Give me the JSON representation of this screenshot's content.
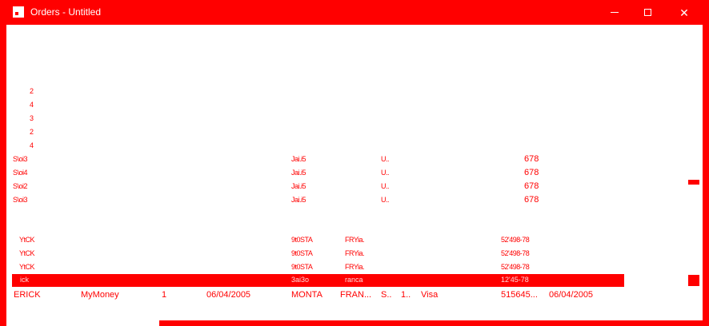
{
  "window": {
    "title": "Orders - Untitled",
    "minimize_glyph": "—",
    "maximize_glyph": "☐",
    "close_glyph": "✕"
  },
  "header_digits": [
    "2",
    "4",
    "3",
    "2",
    "4"
  ],
  "group_a": [
    {
      "id": "S\\oi3",
      "city": "Jai.i5",
      "code": "U..",
      "amount": "678"
    },
    {
      "id": "S\\oi4",
      "city": "Jai.i5",
      "code": "U..",
      "amount": "678"
    },
    {
      "id": "S\\oi2",
      "city": "Jai.i5",
      "code": "U..",
      "amount": "678"
    },
    {
      "id": "S\\oi3",
      "city": "Jai.i5",
      "code": "U..",
      "amount": "678"
    }
  ],
  "group_b": [
    {
      "name": "YtCK",
      "place": "9t0STA",
      "country": "FRYia.",
      "phone": "52'498-78"
    },
    {
      "name": "YtCK",
      "place": "9t0STA",
      "country": "FRYia.",
      "phone": "52'498-78"
    },
    {
      "name": "YtCK",
      "place": "9t0STA",
      "country": "FRYia.",
      "phone": "52'498-78"
    }
  ],
  "selected_row": {
    "name": "ick",
    "place": "3ai3o",
    "country": "ranca",
    "phone": "12'45-78"
  },
  "last_row": {
    "name": "ERICK",
    "company": "MyMoney",
    "qty": "1",
    "date": "06/04/2005",
    "place": "MONTA",
    "country": "FRAN...",
    "s": "S..",
    "one": "1..",
    "card": "Visa",
    "phone": "515645...",
    "date2": "06/04/2005"
  }
}
